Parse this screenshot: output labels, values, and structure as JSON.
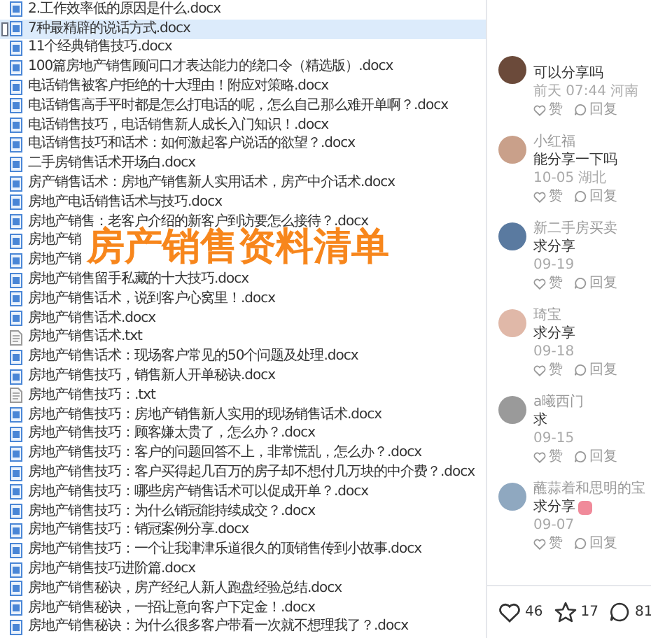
{
  "files": [
    {
      "name": "2.工作效率低的原因是什么.docx",
      "kind": "document",
      "selected": false
    },
    {
      "name": "7种最精辟的说话方式.docx",
      "kind": "document",
      "selected": true
    },
    {
      "name": "11个经典销售技巧.docx",
      "kind": "document",
      "selected": false
    },
    {
      "name": "100篇房地产销售顾问口才表达能力的绕口令（精选版）.docx",
      "kind": "document",
      "selected": false
    },
    {
      "name": "电话销售被客户拒绝的十大理由！附应对策略.docx",
      "kind": "document",
      "selected": false
    },
    {
      "name": "电话销售高手平时都是怎么打电话的呢，怎么自己那么难开单啊？.docx",
      "kind": "document",
      "selected": false
    },
    {
      "name": "电话销售技巧，电话销售新人成长入门知识！.docx",
      "kind": "document",
      "selected": false
    },
    {
      "name": "电话销售技巧和话术：如何激起客户说话的欲望？.docx",
      "kind": "document",
      "selected": false
    },
    {
      "name": "二手房销售话术开场白.docx",
      "kind": "document",
      "selected": false
    },
    {
      "name": "房产销售话术：房地产销售新人实用话术，房产中介话术.docx",
      "kind": "document",
      "selected": false
    },
    {
      "name": "房地产电话销售话术与技巧.docx",
      "kind": "document",
      "selected": false
    },
    {
      "name": "房地产销售：老客户介绍的新客户到访要怎么接待？.docx",
      "kind": "document",
      "selected": false
    },
    {
      "name": "房地产销",
      "kind": "document",
      "selected": false
    },
    {
      "name": "房地产销",
      "kind": "document",
      "selected": false
    },
    {
      "name": "房地产销售留手私藏的十大技巧.docx",
      "kind": "document",
      "selected": false
    },
    {
      "name": "房地产销售话术，说到客户心窝里！.docx",
      "kind": "document",
      "selected": false
    },
    {
      "name": "房地产销售话术.docx",
      "kind": "document",
      "selected": false
    },
    {
      "name": "房地产销售话术.txt",
      "kind": "text",
      "selected": false
    },
    {
      "name": "房地产销售话术：现场客户常见的50个问题及处理.docx",
      "kind": "document",
      "selected": false
    },
    {
      "name": "房地产销售技巧，销售新人开单秘诀.docx",
      "kind": "document",
      "selected": false
    },
    {
      "name": "房地产销售技巧：.txt",
      "kind": "text",
      "selected": false
    },
    {
      "name": "房地产销售技巧：房地产销售新人实用的现场销售话术.docx",
      "kind": "document",
      "selected": false
    },
    {
      "name": "房地产销售技巧：顾客嫌太贵了，怎么办？.docx",
      "kind": "document",
      "selected": false
    },
    {
      "name": "房地产销售技巧：客户的问题回答不上，非常慌乱，怎么办？.docx",
      "kind": "document",
      "selected": false
    },
    {
      "name": "房地产销售技巧：客户买得起几百万的房子却不想付几万块的中介费？.docx",
      "kind": "document",
      "selected": false
    },
    {
      "name": "房地产销售技巧：哪些房产销售话术可以促成开单？.docx",
      "kind": "document",
      "selected": false
    },
    {
      "name": "房地产销售技巧：为什么销冠能持续成交？.docx",
      "kind": "document",
      "selected": false
    },
    {
      "name": "房地产销售技巧：销冠案例分享.docx",
      "kind": "document",
      "selected": false
    },
    {
      "name": "房地产销售技巧：一个让我津津乐道很久的顶销售传到小故事.docx",
      "kind": "document",
      "selected": false
    },
    {
      "name": "房地产销售技巧进阶篇.docx",
      "kind": "document",
      "selected": false
    },
    {
      "name": "房地产销售秘诀，房产经纪人新人跑盘经验总结.docx",
      "kind": "document",
      "selected": false
    },
    {
      "name": "房地产销售秘诀，一招让意向客户下定金！.docx",
      "kind": "document",
      "selected": false
    },
    {
      "name": "房地产销售秘诀：为什么很多客户带看一次就不想理我了？.docx",
      "kind": "document",
      "selected": false
    }
  ],
  "overlay_title": "房产销售资料清单",
  "comments": [
    {
      "text": "可以分享吗",
      "meta": "前天 07:44 河南",
      "like": "赞",
      "reply": "回复",
      "sticker": false
    },
    {
      "author": "小红福",
      "text": "能分享一下吗",
      "meta": "10-05 湖北",
      "like": "赞",
      "reply": "回复",
      "sticker": false
    },
    {
      "author": "新二手房买卖",
      "text": "求分享",
      "meta": "09-19",
      "like": "赞",
      "reply": "回复",
      "sticker": false
    },
    {
      "author": "琦宝",
      "text": "求分享",
      "meta": "09-18",
      "like": "赞",
      "reply": "回复",
      "sticker": false
    },
    {
      "author": "a曦西门",
      "text": "求",
      "meta": "09-15",
      "like": "赞",
      "reply": "回复",
      "sticker": false
    },
    {
      "author": "蘸蒜着和思明的宝",
      "text": "求分享",
      "meta": "09-07",
      "like": "赞",
      "reply": "回复",
      "sticker": true
    }
  ],
  "actions": [
    {
      "kind": "like",
      "count": "46"
    },
    {
      "kind": "star",
      "count": "17"
    },
    {
      "kind": "comment",
      "count": "81"
    }
  ]
}
